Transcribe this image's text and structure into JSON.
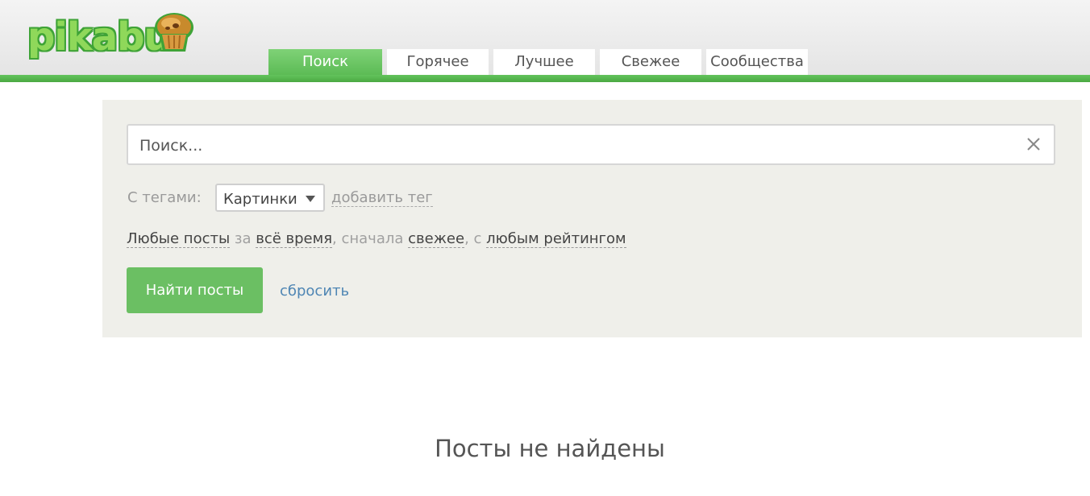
{
  "logo": {
    "text": "pikabu"
  },
  "tabs": [
    {
      "label": "Поиск",
      "active": true
    },
    {
      "label": "Горячее",
      "active": false
    },
    {
      "label": "Лучшее",
      "active": false
    },
    {
      "label": "Свежее",
      "active": false
    },
    {
      "label": "Сообщества",
      "active": false
    }
  ],
  "search": {
    "placeholder": "Поиск...",
    "value": ""
  },
  "tags": {
    "label": "С тегами:",
    "selected": "Картинки",
    "add_label": "добавить тег"
  },
  "filters": {
    "posts": "Любые посты",
    "sep1": " за ",
    "period": "всё время",
    "sep2": ", сначала ",
    "order": "свежее",
    "sep3": ", с ",
    "rating": "любым рейтингом"
  },
  "actions": {
    "find_label": "Найти посты",
    "reset_label": "сбросить"
  },
  "results": {
    "empty_message": "Посты не найдены"
  },
  "colors": {
    "accent": "#5cbb55",
    "link": "#4f86b4",
    "panel_bg": "#efefea"
  }
}
